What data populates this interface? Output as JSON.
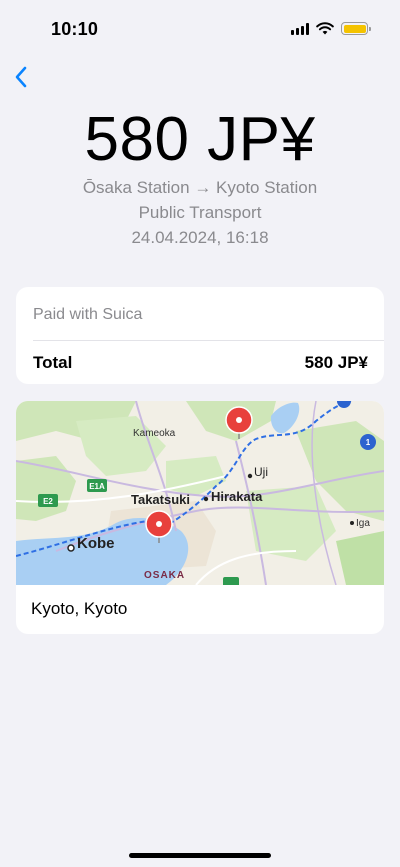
{
  "status_bar": {
    "time": "10:10",
    "icons": [
      "signal-icon",
      "wifi-icon",
      "battery-icon"
    ],
    "battery_color": "#f4c300"
  },
  "nav": {
    "back_icon": "chevron-left-icon",
    "accent": "#0a84ff"
  },
  "transaction": {
    "amount": "580 JP¥",
    "route": "Ōsaka Station → Kyoto Station",
    "category": "Public Transport",
    "datetime": "24.04.2024, 16:18"
  },
  "payment": {
    "paid_with": "Paid with Suica",
    "total_label": "Total",
    "total_value": "580 JP¥"
  },
  "map": {
    "labels": {
      "kameoka": "Kameoka",
      "uji": "Uji",
      "takatsuki": "Takatsuki",
      "hirakata": "Hirakata",
      "kobe": "Kobe",
      "osaka": "OSAKA",
      "iga": "Iga",
      "e2": "E2",
      "e1a": "E1A",
      "route1": "1"
    },
    "pin_icon": "map-pin-icon",
    "pin_color": "#e8403c",
    "location": "Kyoto, Kyoto"
  }
}
